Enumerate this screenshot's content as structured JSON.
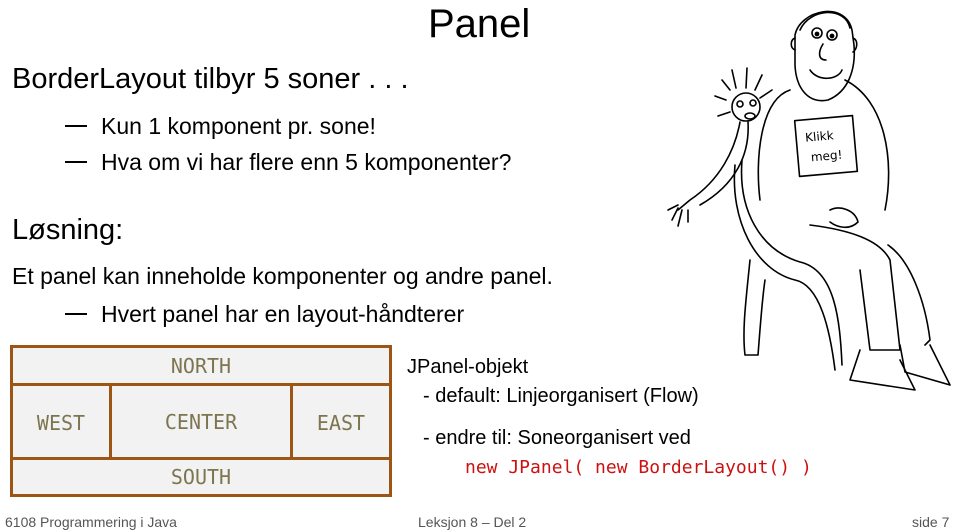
{
  "slide": {
    "title": "Panel",
    "heading1": "BorderLayout tilbyr 5 soner . . .",
    "bullets1": [
      "Kun 1 komponent pr. sone!",
      "Hva om vi har flere enn 5 komponenter?"
    ],
    "heading2": "Løsning:",
    "line2": "Et panel kan inneholde komponenter og andre panel.",
    "bullets2": [
      "Hvert panel har en layout-håndterer"
    ]
  },
  "border_layout": {
    "north": "NORTH",
    "west": "WEST",
    "center": "CENTER",
    "east": "EAST",
    "south": "SOUTH",
    "colors": {
      "border": "#9c5514",
      "fill": "#f2f2f2",
      "text": "#7d7550"
    }
  },
  "jpanel_note": {
    "title": "JPanel-objekt",
    "line1": "- default: Linjeorganisert (Flow)",
    "line2": "- endre til: Soneorganisert ved",
    "code": "new JPanel( new BorderLayout() )",
    "code_color": "#cc1111"
  },
  "cartoon": {
    "icon": "man-on-chair-illustration",
    "sign_big": "Klikk meg!",
    "sign_small": "Kl"
  },
  "footer": {
    "course": "6108 Programmering i Java",
    "lesson": "Leksjon 8 – Del 2",
    "page": "side 7"
  }
}
